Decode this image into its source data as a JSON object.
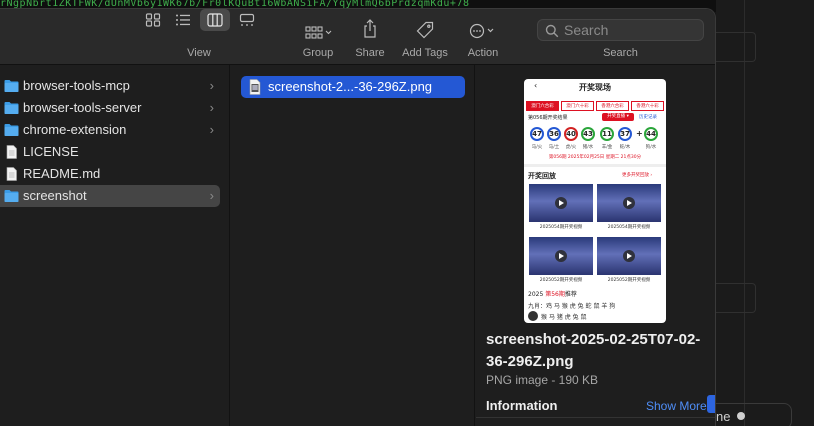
{
  "background": {
    "terminal_text": "rNgpNbrt1ZKTFWK/dUnMVb6y1WK67b/Fr0lKQuBt16WbANSiFA/YqyMlmQ6bPrdzqmKdu+78",
    "right_pill_text": "ne"
  },
  "toolbar": {
    "view_label": "View",
    "group_label": "Group",
    "share_label": "Share",
    "tags_label": "Add Tags",
    "action_label": "Action",
    "search_label": "Search",
    "search_placeholder": "Search"
  },
  "column1": {
    "items": [
      {
        "name": "browser-tools-mcp",
        "kind": "folder",
        "chevron": "›"
      },
      {
        "name": "browser-tools-server",
        "kind": "folder",
        "chevron": "›"
      },
      {
        "name": "chrome-extension",
        "kind": "folder",
        "chevron": "›"
      },
      {
        "name": "LICENSE",
        "kind": "file",
        "chevron": ""
      },
      {
        "name": "README.md",
        "kind": "file",
        "chevron": ""
      },
      {
        "name": "screenshot",
        "kind": "folder",
        "chevron": "›",
        "selected": true
      }
    ]
  },
  "column2": {
    "selected_file": "screenshot-2...-36-296Z.png"
  },
  "preview": {
    "filename": "screenshot-2025-02-25T07-02-36-296Z.png",
    "kind": "PNG image - 190 KB",
    "information_label": "Information",
    "show_more_label": "Show More",
    "thumbnail": {
      "back": "‹",
      "title": "开奖现场",
      "tabs": [
        "澳门六合彩",
        "澳门六十彩",
        "香港六合彩",
        "香港六十彩"
      ],
      "header_left": "第056期开奖结果",
      "header_button": "开奖直播 ▾",
      "header_right": "历史记录",
      "balls": [
        {
          "num": "47",
          "label": "马/火",
          "color": "#2458d4"
        },
        {
          "num": "36",
          "label": "马/土",
          "color": "#2458d4"
        },
        {
          "num": "40",
          "label": "虎/火",
          "color": "#d12222"
        },
        {
          "num": "43",
          "label": "猪/水",
          "color": "#2aa53a"
        },
        {
          "num": "11",
          "label": "羊/金",
          "color": "#2aa53a"
        },
        {
          "num": "37",
          "label": "蛇/木",
          "color": "#2458d4"
        },
        {
          "num": "44",
          "label": "狗/水",
          "color": "#2aa53a"
        }
      ],
      "plus": "+",
      "next_draw": "第056期 2025年02月25日 星期二 21点30分",
      "section_title": "开奖回放",
      "section_more": "更多开奖回放 ›",
      "videos": [
        "2025054期开奖视频",
        "2025054期开奖视频",
        "2025052期开奖视频",
        "2025052期开奖视频"
      ],
      "promo_year": "2025",
      "promo_period": "第56期",
      "promo_suffix": "推荐",
      "line2": "九肖：鸡 马 猴 虎 兔 蛇 鼠 羊 狗",
      "line3": "猴 马 猪 虎 兔 鼠"
    }
  }
}
